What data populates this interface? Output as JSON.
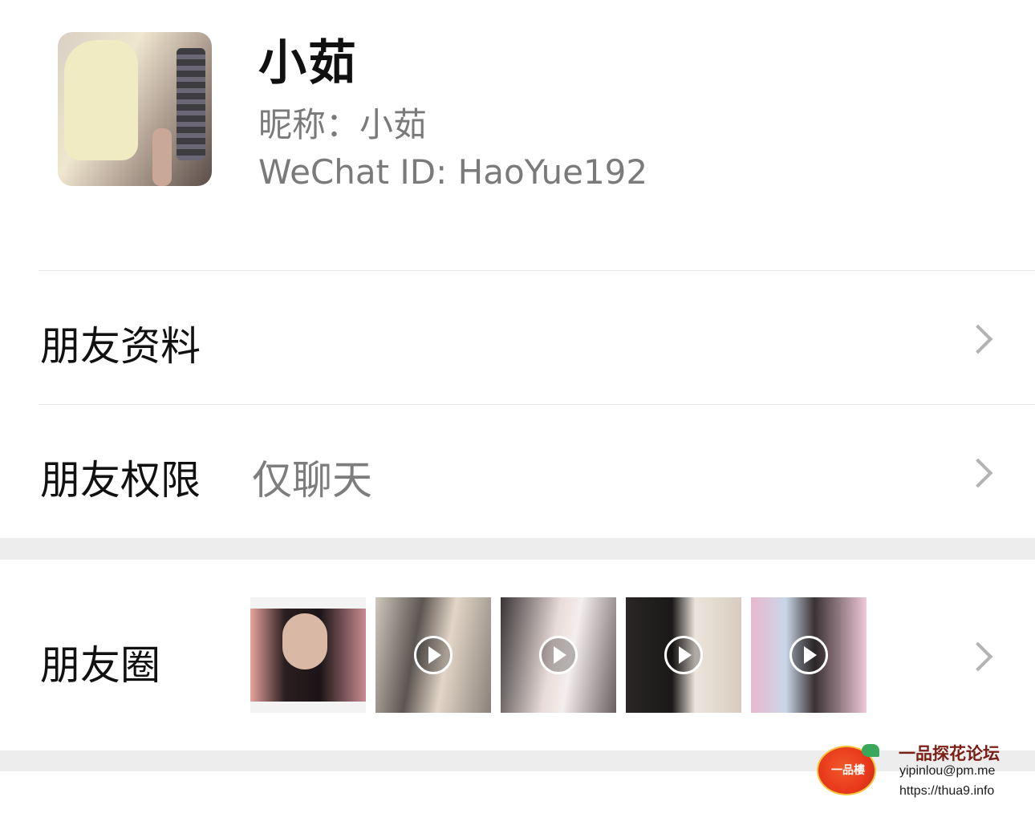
{
  "profile": {
    "display_name": "小茹",
    "nickname_line": "昵称：小茹",
    "wechat_id_line": "WeChat ID: HaoYue192"
  },
  "rows": {
    "friend_info": {
      "label": "朋友资料"
    },
    "friend_permission": {
      "label": "朋友权限",
      "value": "仅聊天"
    },
    "moments": {
      "label": "朋友圈"
    }
  },
  "moments_thumbnails": [
    {
      "kind": "screenshot",
      "has_play": false
    },
    {
      "kind": "video",
      "has_play": true
    },
    {
      "kind": "video",
      "has_play": true
    },
    {
      "kind": "video",
      "has_play": true
    },
    {
      "kind": "video",
      "has_play": true
    }
  ],
  "watermark": {
    "title": "一品探花论坛",
    "email": "yipinlou@pm.me",
    "url": "https://thua9.info",
    "logo_text": "一品樓"
  },
  "colors": {
    "secondary_text": "#7a7a7a",
    "divider": "#e6e6e6",
    "section_gap": "#ededed",
    "chevron": "#b3b3b3"
  },
  "icons": [
    "chevron-right-icon",
    "play-icon"
  ]
}
